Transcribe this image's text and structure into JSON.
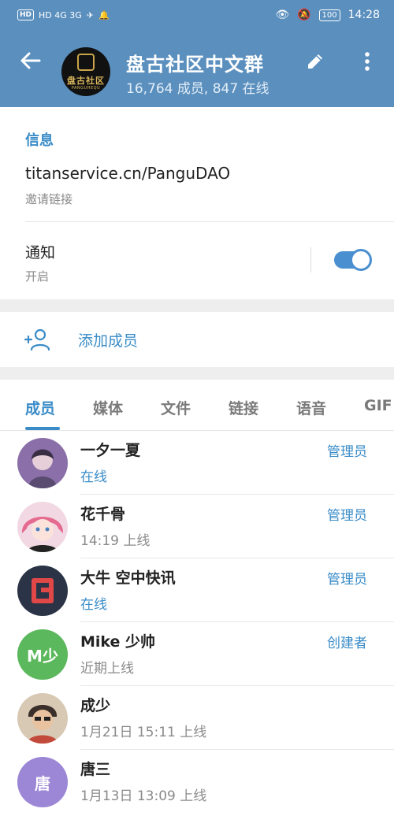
{
  "status_bar": {
    "left_indicators": "HD 4G 3G",
    "time": "14:28",
    "battery": "100"
  },
  "header": {
    "group_name": "盘古社区中文群",
    "stats": "16,764 成员, 847 在线",
    "avatar_text": "盘古社区",
    "avatar_subtext": "PANGUHEQU"
  },
  "info": {
    "section_title": "信息",
    "invite_link": "titanservice.cn/PanguDAO",
    "invite_label": "邀请链接",
    "notify_label": "通知",
    "notify_state": "开启"
  },
  "add_member": {
    "label": "添加成员"
  },
  "tabs": [
    {
      "label": "成员",
      "active": true
    },
    {
      "label": "媒体",
      "active": false
    },
    {
      "label": "文件",
      "active": false
    },
    {
      "label": "链接",
      "active": false
    },
    {
      "label": "语音",
      "active": false
    },
    {
      "label": "GIF",
      "active": false
    }
  ],
  "members": [
    {
      "name": "一夕一夏",
      "status": "在线",
      "role": "管理员",
      "avatar_color": "#8a6fa8"
    },
    {
      "name": "花千骨",
      "status": "14:19 上线",
      "role": "管理员",
      "avatar_color": "#e79bb3"
    },
    {
      "name": "大牛 空中快讯",
      "status": "在线",
      "role": "管理员",
      "avatar_color": "#2b3446"
    },
    {
      "name": "Mike 少帅",
      "status": "近期上线",
      "role": "创建者",
      "avatar_color": "#5cb85c",
      "avatar_text": "M少"
    },
    {
      "name": "成少",
      "status": "1月21日 15:11 上线",
      "role": "",
      "avatar_color": "#b89a7a"
    },
    {
      "name": "唐三",
      "status": "1月13日 13:09 上线",
      "role": "",
      "avatar_color": "#9c86d6",
      "avatar_text": "唐"
    }
  ],
  "colors": {
    "header_bg": "#5b8fbe",
    "accent": "#3a8cc8"
  }
}
